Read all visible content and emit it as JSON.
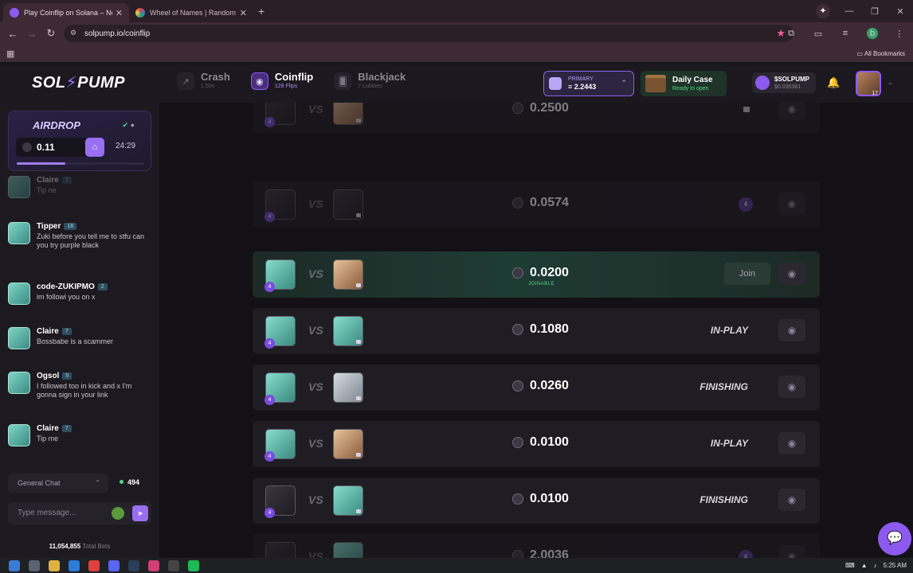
{
  "browser": {
    "tabs": [
      {
        "title": "Play Coinflip on Solana – No K",
        "close": "✕"
      },
      {
        "title": "Wheel of Names | Random nam",
        "close": "✕"
      }
    ],
    "new_tab": "+",
    "url": "solpump.io/coinflip",
    "bookmarks_label": "All Bookmarks"
  },
  "site": {
    "logo_left": "SOL",
    "logo_bolt": "⚡",
    "logo_right": "PUMP",
    "games": [
      {
        "name": "Crash",
        "sub": "1.50x",
        "icon": "trend-icon",
        "active": false
      },
      {
        "name": "Coinflip",
        "sub": "128 Flips",
        "icon": "coin-icon",
        "active": true
      },
      {
        "name": "Blackjack",
        "sub": "7 Lobbies",
        "icon": "cards-icon",
        "active": false
      }
    ],
    "wallet": {
      "label": "PRIMARY",
      "balance": "≡ 2.2443"
    },
    "daily_case": {
      "title": "Daily Case",
      "status": "Ready to open"
    },
    "token": {
      "name": "$SOLPUMP",
      "price": "$0.035381"
    },
    "user_level": "17"
  },
  "airdrop": {
    "title": "AIRDROP",
    "amount": "0.11",
    "timer": "24:29",
    "progress_pct": 38
  },
  "chat": {
    "messages": [
      {
        "user": "Claire",
        "level": "7",
        "text": "Tip ne",
        "faded": true
      },
      {
        "user": "Tipper",
        "level": "18",
        "text": "Zuki before you tell me to stfu can you try purple black",
        "faded": false
      },
      {
        "user": "code-ZUKIPMO",
        "level": "2",
        "text": "im followi you on x",
        "faded": false
      },
      {
        "user": "Claire",
        "level": "7",
        "text": "Bossbabe is a scammer",
        "faded": false
      },
      {
        "user": "Ogsol",
        "level": "5",
        "text": "I followed too in kick and x I'm gonna sign in your link",
        "faded": false
      },
      {
        "user": "Claire",
        "level": "7",
        "text": "Tip me",
        "faded": false
      }
    ],
    "room": "General Chat",
    "online": "494",
    "input_placeholder": "Type message...",
    "total_bets_value": "11,054,855",
    "total_bets_label": "Total Bets"
  },
  "lobbies": [
    {
      "amount": "0.2500",
      "status": "",
      "dim": true,
      "join": false
    },
    {
      "amount": "0.0574",
      "status": "",
      "dim": true,
      "join": false
    },
    {
      "amount": "0.0200",
      "status": "",
      "sub": "JOINABLE",
      "dim": false,
      "join": true
    },
    {
      "amount": "0.1080",
      "status": "IN-PLAY",
      "dim": false,
      "join": false
    },
    {
      "amount": "0.0260",
      "status": "FINISHING",
      "dim": false,
      "join": false
    },
    {
      "amount": "0.0100",
      "status": "IN-PLAY",
      "dim": false,
      "join": false
    },
    {
      "amount": "0.0100",
      "status": "FINISHING",
      "dim": false,
      "join": false
    },
    {
      "amount": "2.0036",
      "status": "",
      "dim": true,
      "join": false
    }
  ],
  "join_label": "Join",
  "vs_label": "VS",
  "level_badge": "4",
  "taskbar": {
    "time": "5:25 AM"
  }
}
